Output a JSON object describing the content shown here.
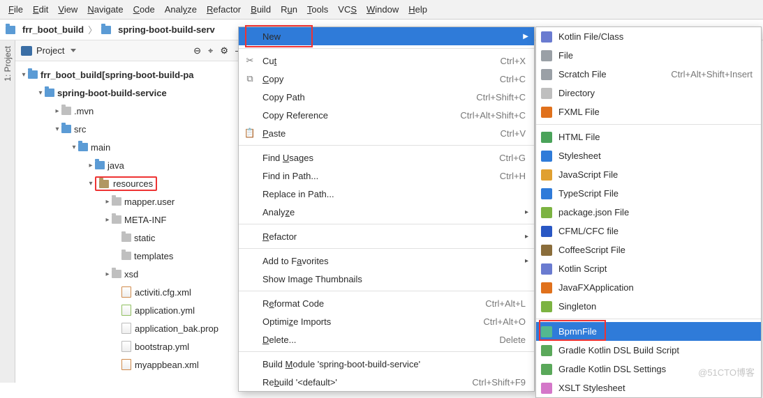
{
  "menubar": [
    "File",
    "Edit",
    "View",
    "Navigate",
    "Code",
    "Analyze",
    "Refactor",
    "Build",
    "Run",
    "Tools",
    "VCS",
    "Window",
    "Help"
  ],
  "menubar_hotidx": [
    0,
    0,
    0,
    0,
    0,
    4,
    0,
    0,
    1,
    0,
    2,
    0,
    0
  ],
  "breadcrumb": {
    "a": "frr_boot_build",
    "b": "spring-boot-build-serv"
  },
  "sidebar": {
    "title": "Project",
    "tab": "1: Project"
  },
  "tree": {
    "root": "frr_boot_build",
    "root_suffix": " [spring-boot-build-pa",
    "mod": "spring-boot-build-service",
    "mvn": ".mvn",
    "src": "src",
    "main": "main",
    "java": "java",
    "resources": "resources",
    "mapper": "mapper.user",
    "meta": "META-INF",
    "static": "static",
    "templates": "templates",
    "xsd": "xsd",
    "files": [
      "activiti.cfg.xml",
      "application.yml",
      "application_bak.prop",
      "bootstrap.yml",
      "myappbean.xml"
    ]
  },
  "ctx": {
    "new": "New",
    "cut": "Cut",
    "cut_sc": "Ctrl+X",
    "copy": "Copy",
    "copy_sc": "Ctrl+C",
    "copypath": "Copy Path",
    "copypath_sc": "Ctrl+Shift+C",
    "copyref": "Copy Reference",
    "copyref_sc": "Ctrl+Alt+Shift+C",
    "paste": "Paste",
    "paste_sc": "Ctrl+V",
    "findusages": "Find Usages",
    "findusages_sc": "Ctrl+G",
    "findinpath": "Find in Path...",
    "findinpath_sc": "Ctrl+H",
    "replaceinpath": "Replace in Path...",
    "analyze": "Analyze",
    "refactor": "Refactor",
    "addfav": "Add to Favorites",
    "showimg": "Show Image Thumbnails",
    "reformat": "Reformat Code",
    "reformat_sc": "Ctrl+Alt+L",
    "optimize": "Optimize Imports",
    "optimize_sc": "Ctrl+Alt+O",
    "delete": "Delete...",
    "delete_sc": "Delete",
    "buildmod": "Build Module 'spring-boot-build-service'",
    "rebuild": "Rebuild '<default>'",
    "rebuild_sc": "Ctrl+Shift+F9"
  },
  "sub": [
    {
      "label": "Kotlin File/Class",
      "color": "#6a7bd0"
    },
    {
      "label": "File",
      "color": "#9aa0a6"
    },
    {
      "label": "Scratch File",
      "color": "#9aa0a6",
      "sc": "Ctrl+Alt+Shift+Insert"
    },
    {
      "label": "Directory",
      "color": "#bfbfbf"
    },
    {
      "label": "FXML File",
      "color": "#e0711c"
    },
    {
      "sep": true
    },
    {
      "label": "HTML File",
      "color": "#4aa35a"
    },
    {
      "label": "Stylesheet",
      "color": "#2f7bd9"
    },
    {
      "label": "JavaScript File",
      "color": "#e0a030"
    },
    {
      "label": "TypeScript File",
      "color": "#2f7bd9"
    },
    {
      "label": "package.json File",
      "color": "#7cb342"
    },
    {
      "label": "CFML/CFC file",
      "color": "#2957c4"
    },
    {
      "label": "CoffeeScript File",
      "color": "#8a6d3b"
    },
    {
      "label": "Kotlin Script",
      "color": "#6a7bd0"
    },
    {
      "label": "JavaFXApplication",
      "color": "#e0711c"
    },
    {
      "label": "Singleton",
      "color": "#7cb342"
    },
    {
      "sep": true
    },
    {
      "label": "BpmnFile",
      "color": "#53b890",
      "sel": true,
      "redbox": true
    },
    {
      "label": "Gradle Kotlin DSL Build Script",
      "color": "#5aa85a"
    },
    {
      "label": "Gradle Kotlin DSL Settings",
      "color": "#5aa85a"
    },
    {
      "label": "XSLT Stylesheet",
      "color": "#d477c9"
    }
  ],
  "watermark": "@51CTO博客"
}
